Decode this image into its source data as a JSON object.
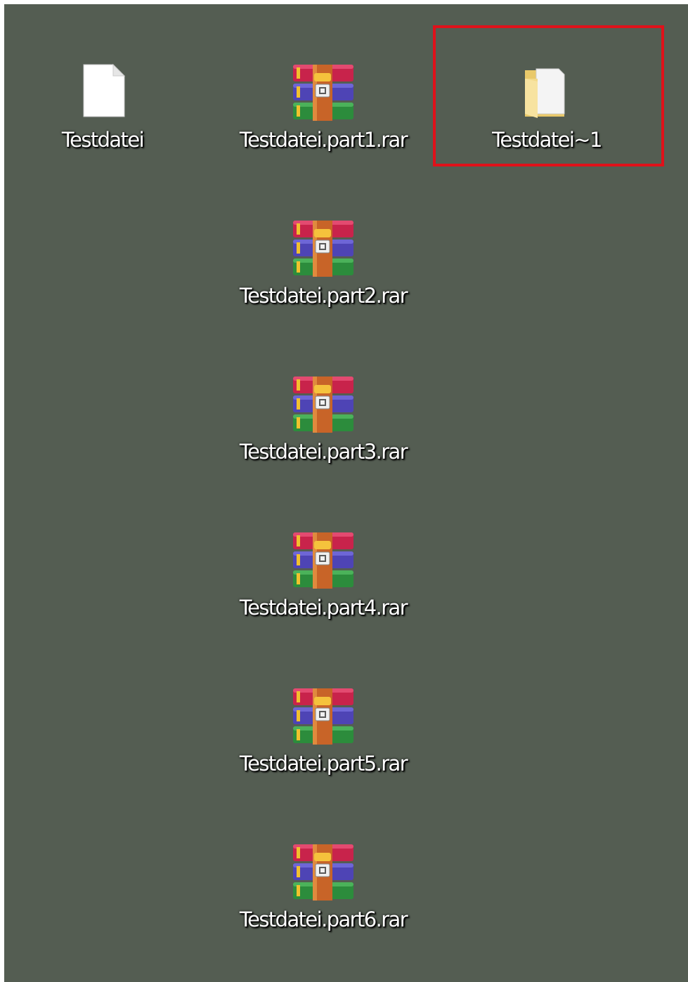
{
  "desktop": {
    "items": [
      {
        "label": "Testdatei",
        "icon": "blank-file-icon"
      },
      {
        "label": "Testdatei.part1.rar",
        "icon": "winrar-archive-icon"
      },
      {
        "label": "Testdatei~1",
        "icon": "folder-icon"
      },
      {
        "label": "Testdatei.part2.rar",
        "icon": "winrar-archive-icon"
      },
      {
        "label": "Testdatei.part3.rar",
        "icon": "winrar-archive-icon"
      },
      {
        "label": "Testdatei.part4.rar",
        "icon": "winrar-archive-icon"
      },
      {
        "label": "Testdatei.part5.rar",
        "icon": "winrar-archive-icon"
      },
      {
        "label": "Testdatei.part6.rar",
        "icon": "winrar-archive-icon"
      }
    ]
  },
  "colors": {
    "background": "#545d52",
    "highlight": "#e0111a",
    "label_text": "#ffffff"
  }
}
